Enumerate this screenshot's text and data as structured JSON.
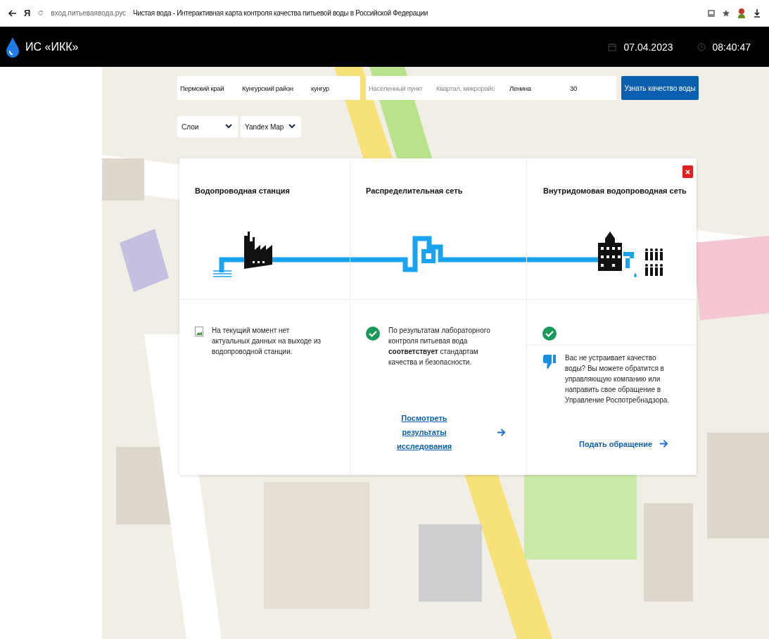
{
  "browser": {
    "logo": "Я",
    "url": "вход.питьеваявода.рус",
    "title": "Чистая вода - Интерактивная карта контроля качества питьевой воды в Российской Федерации"
  },
  "header": {
    "logo": "ИС «ИКК»",
    "date": "07.04.2023",
    "time": "08:40:47"
  },
  "address_form": {
    "fields": [
      {
        "value": "Пермский край"
      },
      {
        "value": "Кунгурский район"
      },
      {
        "value": "кунгур"
      },
      {
        "placeholder": "Населенный пункт"
      },
      {
        "placeholder": "Квартал, микрорайс"
      },
      {
        "value": "Ленина"
      },
      {
        "value": "30"
      }
    ],
    "submit": "Узнать качество воды"
  },
  "map_selects": [
    {
      "value": "Слои"
    },
    {
      "value": "Yandex Map"
    }
  ],
  "panel": {
    "columns": [
      {
        "title": "Водопроводная станция",
        "kind": "no_data",
        "message": "На текущий момент нет актуальных данных на выходе из водопроводной станции."
      },
      {
        "title": "Распределительная сеть",
        "kind": "ok",
        "message": "По результатам лабораторного контроля питьевая вода **соответствует** стандартам качества и безопасности.",
        "link": "Посмотреть результаты исследования"
      },
      {
        "title": "Внутридомовая водопроводная сеть",
        "kind": "ok",
        "complaint": "Вас не устраивает качество воды? Вы можете обратится в управляющую компанию или направить свое обращение в Управление Роспотребнадзора.",
        "link": "Подать обращение"
      }
    ]
  }
}
